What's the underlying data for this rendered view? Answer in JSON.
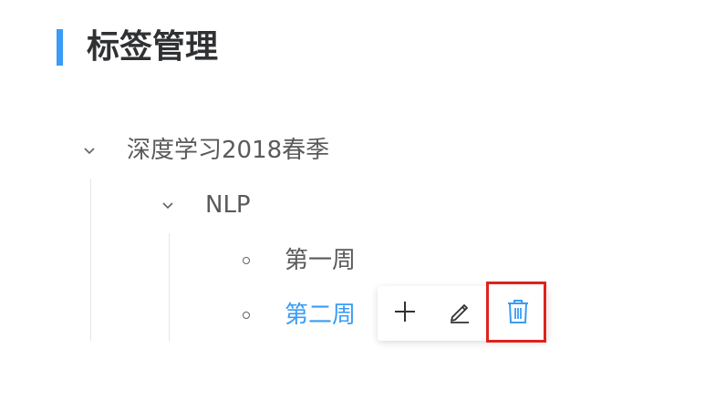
{
  "page": {
    "title": "标签管理"
  },
  "tree": {
    "root": {
      "label": "深度学习2018春季",
      "expanded": true,
      "children": [
        {
          "label": "NLP",
          "expanded": true,
          "children": [
            {
              "label": "第一周",
              "selected": false
            },
            {
              "label": "第二周",
              "selected": true
            }
          ]
        }
      ]
    }
  },
  "toolbar": {
    "actions": [
      {
        "name": "add",
        "icon": "plus-icon"
      },
      {
        "name": "edit",
        "icon": "pencil-icon"
      },
      {
        "name": "delete",
        "icon": "trash-icon",
        "highlighted": true
      }
    ]
  },
  "colors": {
    "accent": "#3a9cf5",
    "text": "#5a5a5a",
    "title": "#303133",
    "highlight_box": "#e0221c",
    "guide_line": "#e4e6ea"
  }
}
